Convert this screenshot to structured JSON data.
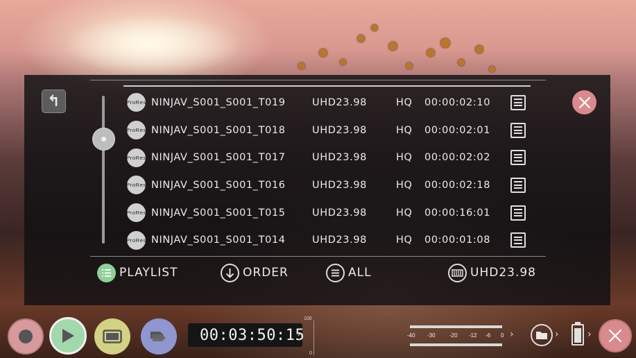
{
  "clips": [
    {
      "codec": "ProRes",
      "name": "NINJAV_S001_S001_T019",
      "resolution": "UHD23.98",
      "quality": "HQ",
      "duration": "00:00:02:10"
    },
    {
      "codec": "ProRes",
      "name": "NINJAV_S001_S001_T018",
      "resolution": "UHD23.98",
      "quality": "HQ",
      "duration": "00:00:02:01"
    },
    {
      "codec": "ProRes",
      "name": "NINJAV_S001_S001_T017",
      "resolution": "UHD23.98",
      "quality": "HQ",
      "duration": "00:00:02:02"
    },
    {
      "codec": "ProRes",
      "name": "NINJAV_S001_S001_T016",
      "resolution": "UHD23.98",
      "quality": "HQ",
      "duration": "00:00:02:18"
    },
    {
      "codec": "ProRes",
      "name": "NINJAV_S001_S001_T015",
      "resolution": "UHD23.98",
      "quality": "HQ",
      "duration": "00:00:16:01"
    },
    {
      "codec": "ProRes",
      "name": "NINJAV_S001_S001_T014",
      "resolution": "UHD23.98",
      "quality": "HQ",
      "duration": "00:00:01:08"
    }
  ],
  "bottom_bar": {
    "playlist": "PLAYLIST",
    "order": "ORDER",
    "all": "ALL",
    "resolution_filter": "UHD23.98"
  },
  "transport": {
    "timecode": "00:03:50:15",
    "level_max": "100",
    "level_min": "0"
  },
  "audio_meter": {
    "labels": [
      "-40",
      "-30",
      "-20",
      "-12",
      "-6",
      "0"
    ]
  },
  "colors": {
    "record": "#d69a9c",
    "play": "#a3d8ad",
    "monitor": "#d3d184",
    "tag": "#8f96d0",
    "close": "#d98a8d",
    "playlist_icon": "#8fcf9b"
  },
  "icons": {
    "up": "up-arrow-icon",
    "close": "close-icon",
    "codec": "prores-icon",
    "clip_menu": "hamburger-icon",
    "playlist": "playlist-icon",
    "order": "down-arrow-icon",
    "all": "list-icon",
    "resolution": "film-icon",
    "folder": "folder-icon",
    "battery": "battery-icon"
  }
}
